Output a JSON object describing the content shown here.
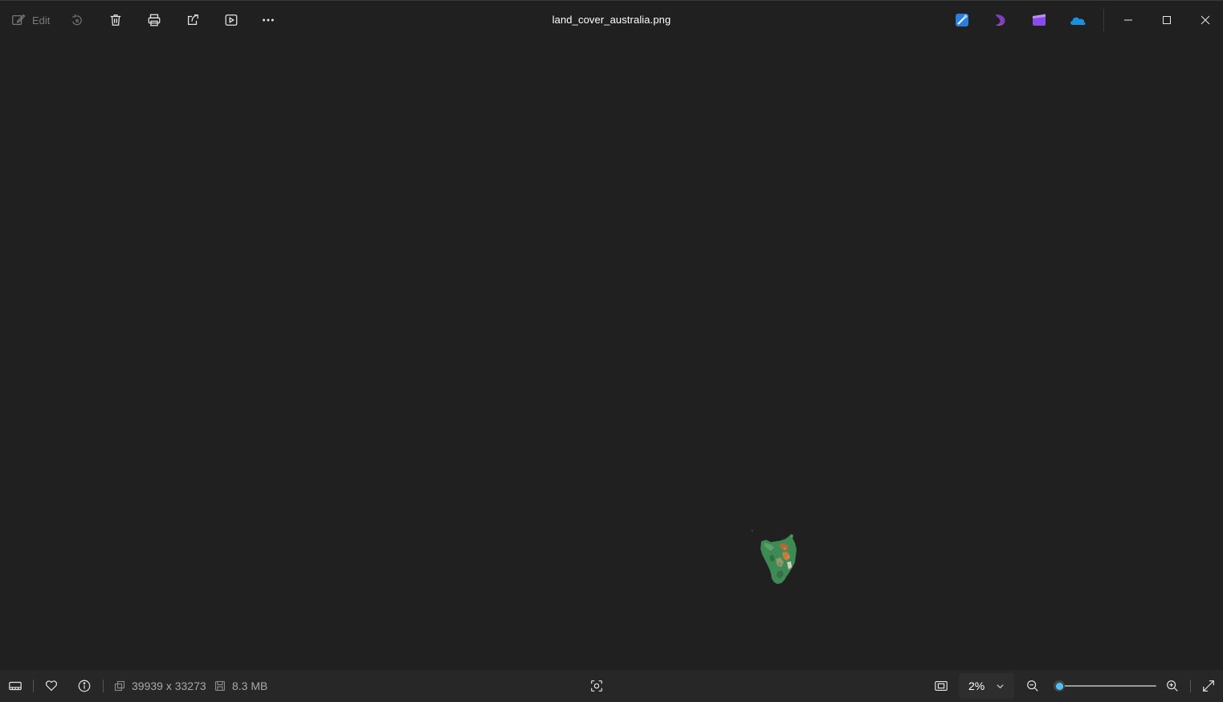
{
  "window": {
    "title": "land_cover_australia.png"
  },
  "toolbar": {
    "edit_label": "Edit",
    "icons": [
      "edit-icon",
      "rotate-icon",
      "delete-icon",
      "print-icon",
      "share-icon",
      "slideshow-icon",
      "more-icon"
    ]
  },
  "title_bar_apps": [
    "designer-icon",
    "clipchamp-swirl-icon",
    "clipchamp-icon",
    "onedrive-icon"
  ],
  "window_controls": [
    "minimize-icon",
    "maximize-icon",
    "close-icon"
  ],
  "status": {
    "dimensions": "39939 x 33273",
    "file_size": "8.3 MB",
    "zoom_value": "2%",
    "zoom_level_fraction": 0.02
  },
  "colors": {
    "background": "#202020",
    "statusbar": "#272727",
    "accent": "#4cc2ff"
  }
}
